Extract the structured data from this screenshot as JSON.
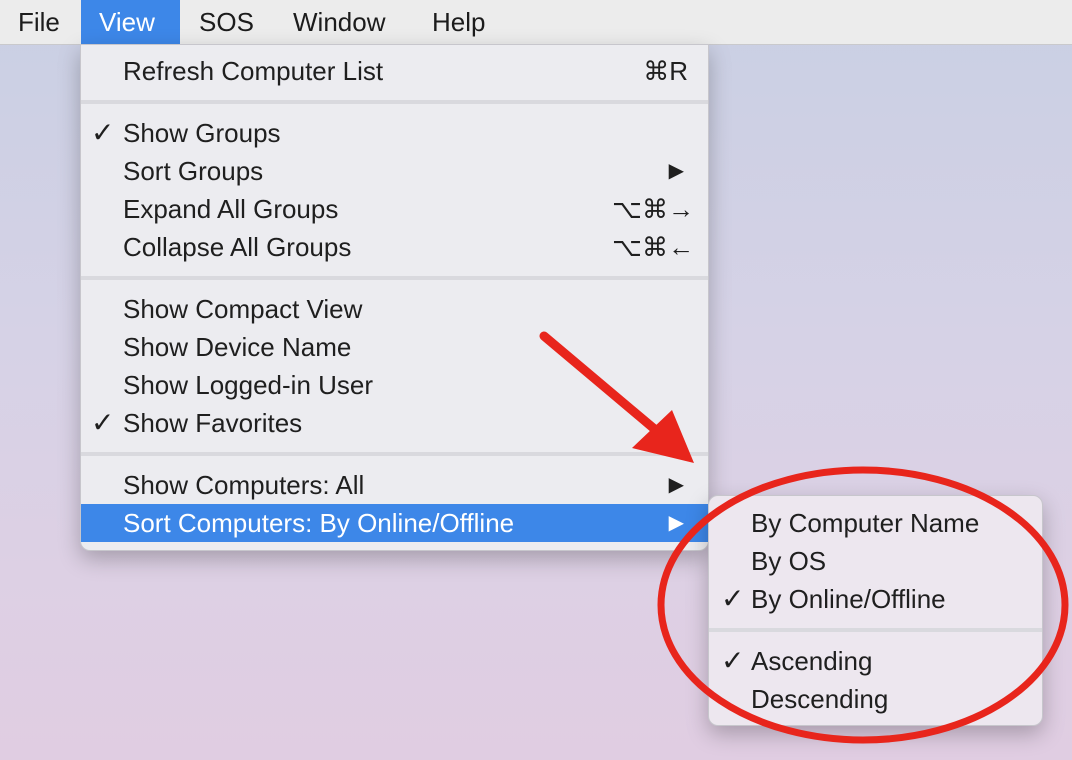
{
  "menubar": {
    "items": [
      "File",
      "View",
      "SOS",
      "Window",
      "Help"
    ]
  },
  "view_menu": {
    "items": [
      {
        "label": "Refresh Computer List",
        "shortcut": "⌘R"
      },
      {
        "label": "Show Groups",
        "checked": true
      },
      {
        "label": "Sort Groups",
        "submenu": true
      },
      {
        "label": "Expand All Groups",
        "shortcut": "⌥⌘→"
      },
      {
        "label": "Collapse All Groups",
        "shortcut": "⌥⌘←"
      },
      {
        "label": "Show Compact View"
      },
      {
        "label": "Show Device Name"
      },
      {
        "label": "Show Logged-in User"
      },
      {
        "label": "Show Favorites",
        "checked": true
      },
      {
        "label": "Show Computers: All",
        "submenu": true
      },
      {
        "label": "Sort Computers: By Online/Offline",
        "submenu": true,
        "highlighted": true
      }
    ]
  },
  "submenu": {
    "items": [
      {
        "label": "By Computer Name"
      },
      {
        "label": "By OS"
      },
      {
        "label": "By Online/Offline",
        "checked": true
      },
      {
        "label": "Ascending",
        "checked": true
      },
      {
        "label": "Descending"
      }
    ]
  },
  "glyphs": {
    "checkmark": "✓",
    "submenu_arrow": "▶"
  },
  "annotation": {
    "color": "#e8251c"
  }
}
